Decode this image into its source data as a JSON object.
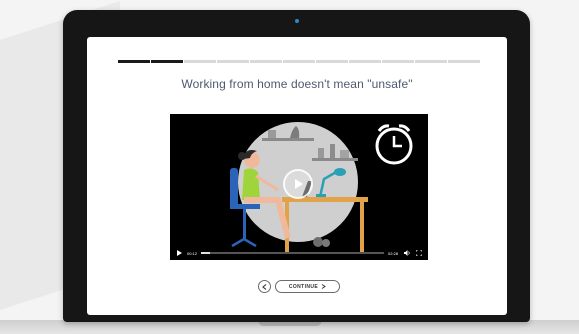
{
  "lesson": {
    "title": "Working from home doesn't mean \"unsafe\"",
    "progress_fraction": 0.18,
    "progress_segments": 11
  },
  "video": {
    "elapsed_time": "00:12",
    "total_time": "02:28",
    "played_fraction": 0.05,
    "icons": {
      "play_overlay": "play-icon",
      "play_button": "play-icon",
      "volume": "volume-icon",
      "fullscreen": "fullscreen-icon",
      "clock": "alarm-clock-icon"
    }
  },
  "navigation": {
    "back_icon": "chevron-left-icon",
    "continue_label": "CONTINUE",
    "continue_icon": "chevron-right-icon"
  },
  "colors": {
    "title_text": "#4f5a6e",
    "laptop_bezel": "#161616",
    "video_bg": "#000000",
    "scene_circle": "#cfcfcf",
    "desk": "#e1a24a",
    "chair": "#2a63b8",
    "shirt": "#9fd43a",
    "lamp": "#2a9fb5",
    "camera_led": "#2f86c8"
  }
}
